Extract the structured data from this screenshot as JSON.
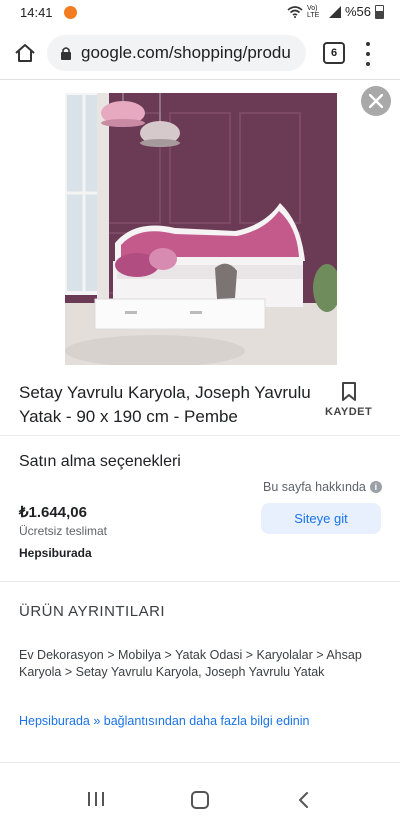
{
  "status_bar": {
    "time": "14:41",
    "network": "Vo) LTE",
    "battery": "%56"
  },
  "browser": {
    "url": "google.com/shopping/produ",
    "tab_count": "6"
  },
  "product": {
    "title": "Setay Yavrulu Karyola, Joseph Yavrulu Yatak - 90 x 190 cm - Pembe",
    "save_label": "KAYDET"
  },
  "purchase": {
    "heading": "Satın alma seçenekleri",
    "about_page": "Bu sayfa hakkında",
    "price": "₺1.644,06",
    "shipping": "Ücretsiz teslimat",
    "visit_button": "Siteye git",
    "merchant": "Hepsiburada"
  },
  "details": {
    "heading": "ÜRÜN AYRINTILARI",
    "breadcrumb": "Ev Dekorasyon > Mobilya > Yatak Odasi > Karyolalar > Ahsap Karyola > Setay Yavrulu Karyola, Joseph Yavrulu Yatak",
    "more_info_link": "Hepsiburada » bağlantısından daha fazla bilgi edinin"
  },
  "colors": {
    "link_blue": "#1a73e8",
    "button_bg": "#e8f0fe",
    "wall_purple": "#6b3a55",
    "headboard_pink": "#c45a8c"
  },
  "icons": {
    "home": "home-icon",
    "lock": "lock-icon",
    "menu": "more-vert-icon",
    "close": "close-icon",
    "save": "bookmark-icon",
    "info": "info-icon"
  }
}
